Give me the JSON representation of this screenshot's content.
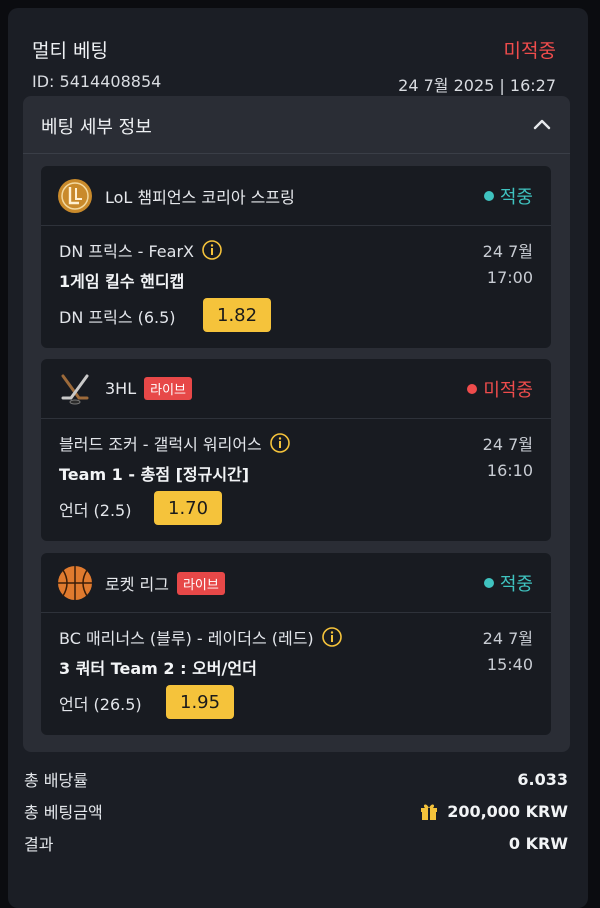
{
  "header": {
    "title": "멀티 베팅",
    "status": "미적중",
    "id": "ID: 5414408854",
    "datetime": "24 7월 2025 | 16:27"
  },
  "details": {
    "title": "베팅 세부 정보"
  },
  "bets": [
    {
      "league": "LoL 챔피언스 코리아 스프링",
      "live": "",
      "status": "적중",
      "match": "DN 프릭스 - FearX",
      "date": "24 7월",
      "market": "1게임 킬수 핸디캡",
      "time": "17:00",
      "selection": "DN 프릭스 (6.5)",
      "odds": "1.82"
    },
    {
      "league": "3HL",
      "live": "라이브",
      "status": "미적중",
      "match": "블러드 조커 - 갤럭시 워리어스",
      "date": "24 7월",
      "market": "Team 1 - 총점 [정규시간]",
      "time": "16:10",
      "selection": "언더 (2.5)",
      "odds": "1.70"
    },
    {
      "league": "로켓 리그",
      "live": "라이브",
      "status": "적중",
      "match": "BC 매리너스 (블루) - 레이더스 (레드)",
      "date": "24 7월",
      "market": "3 쿼터 Team 2 : 오버/언더",
      "time": "15:40",
      "selection": "언더 (26.5)",
      "odds": "1.95"
    }
  ],
  "summary": {
    "total_odds_label": "총 배당률",
    "total_odds": "6.033",
    "total_stake_label": "총 베팅금액",
    "total_stake": "200,000 KRW",
    "result_label": "결과",
    "result": "0 KRW"
  },
  "colors": {
    "won": "#3fc3c0",
    "lost": "#ef4c4c",
    "odds_bg": "#f5c33b",
    "live_bg": "#e74848"
  },
  "icons": [
    "lol-logo-icon",
    "hockey-sticks-icon",
    "basketball-icon",
    "info-icon",
    "chevron-up-icon",
    "gift-icon"
  ]
}
